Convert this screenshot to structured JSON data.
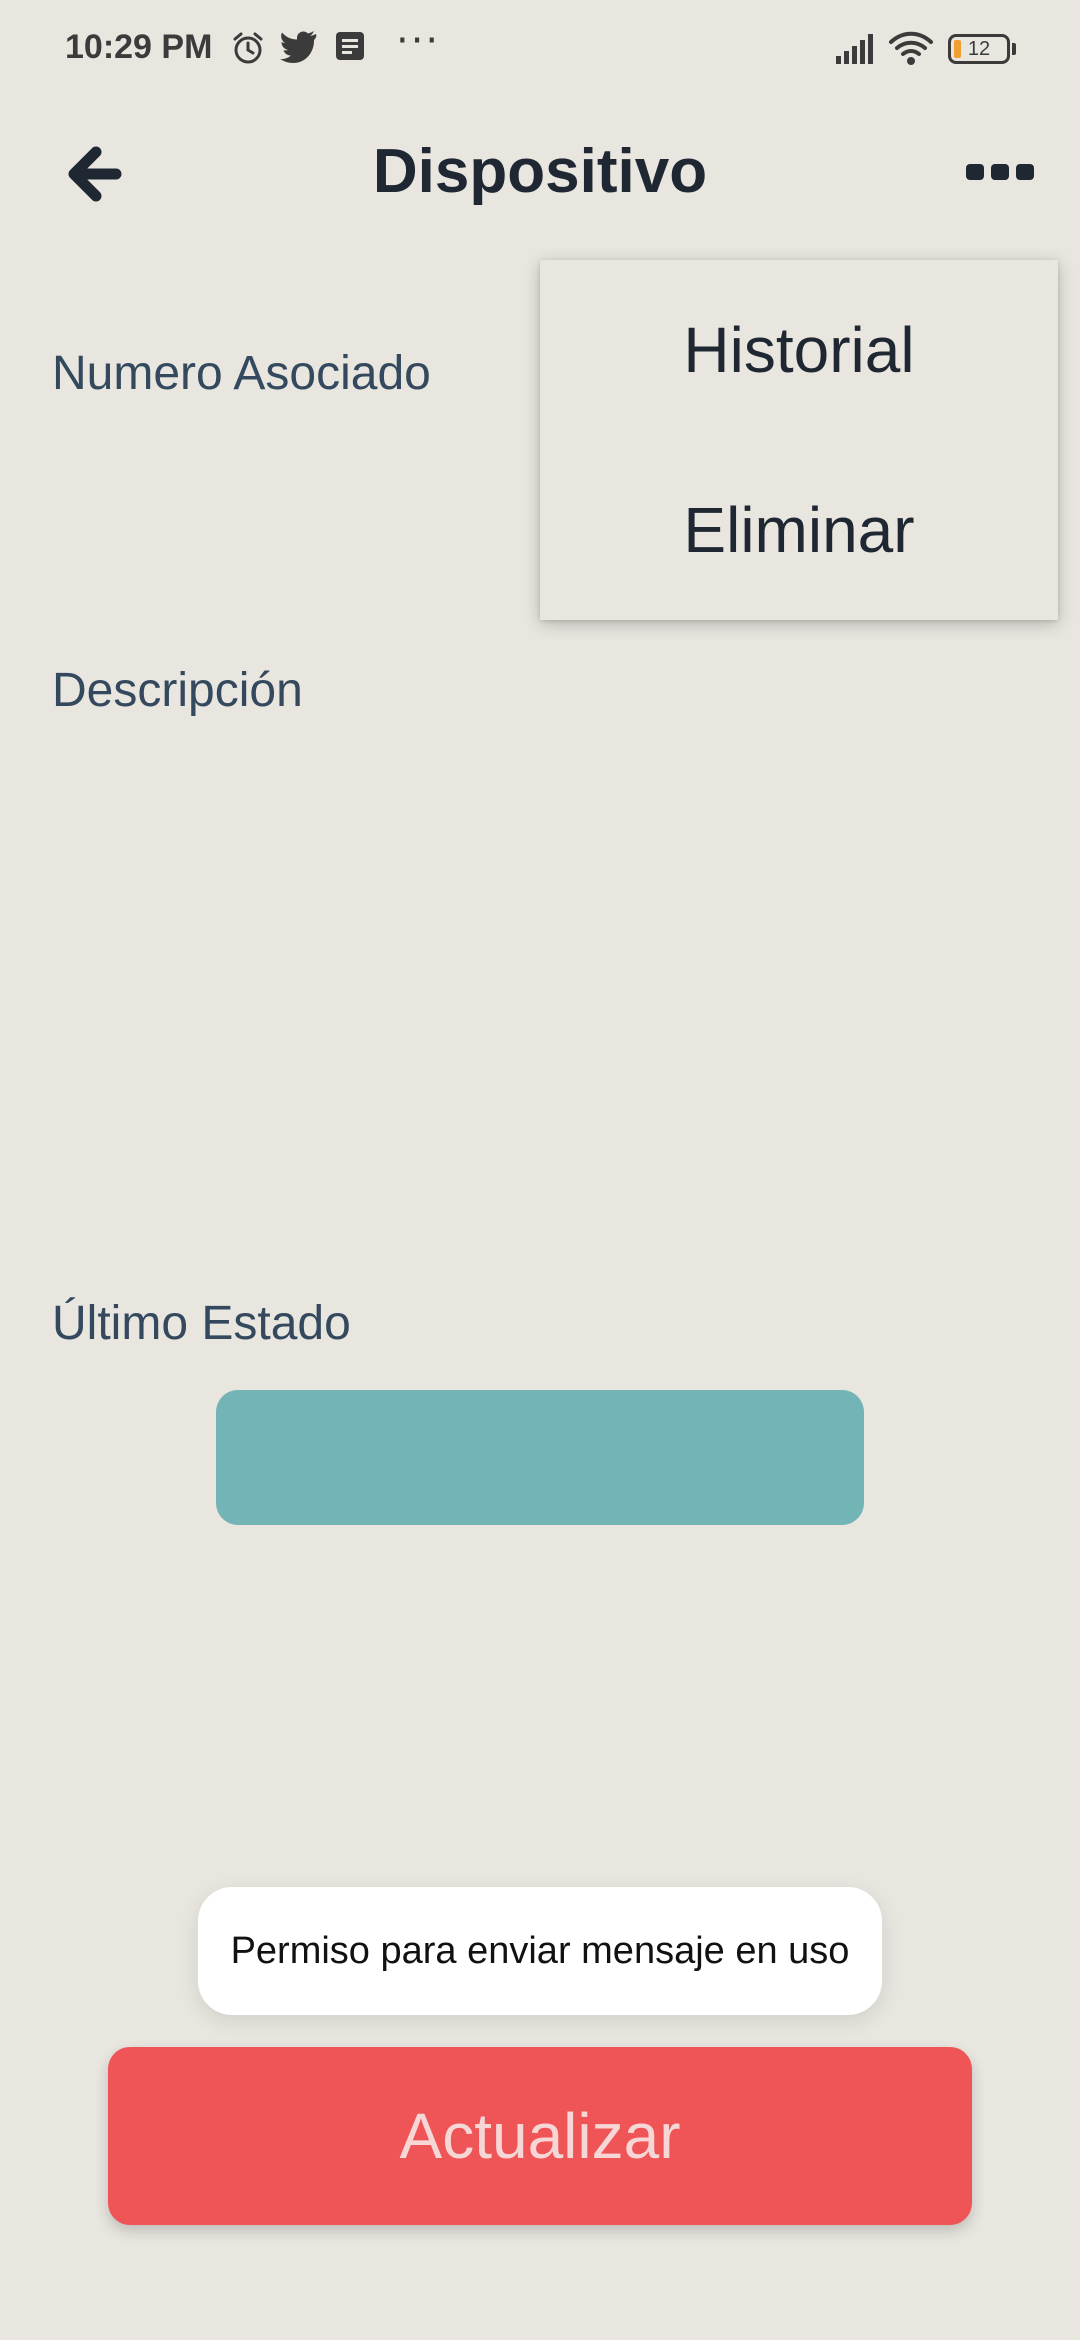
{
  "status_bar": {
    "time": "10:29 PM",
    "more": "···",
    "battery_level": "12",
    "icons": [
      "alarm-icon",
      "twitter-icon",
      "message-icon",
      "signal-icon",
      "wifi-icon",
      "battery-icon"
    ],
    "battery_color": "#f0a030"
  },
  "app_bar": {
    "title": "Dispositivo",
    "back_icon": "arrow-left-icon",
    "more_icon": "more-horizontal-icon"
  },
  "form": {
    "associated_number_label": "Numero Asociado",
    "description_label": "Descripción",
    "last_state_label": "Último Estado",
    "last_state_color": "#73b5b6"
  },
  "menu": {
    "items": [
      {
        "label": "Historial"
      },
      {
        "label": "Eliminar"
      }
    ]
  },
  "toast": {
    "message": "Permiso para enviar mensaje en uso"
  },
  "actions": {
    "update_label": "Actualizar",
    "update_color": "#ef5457"
  },
  "colors": {
    "background": "#e8e6df",
    "text_dark": "#1f2733",
    "label": "#34495e"
  }
}
